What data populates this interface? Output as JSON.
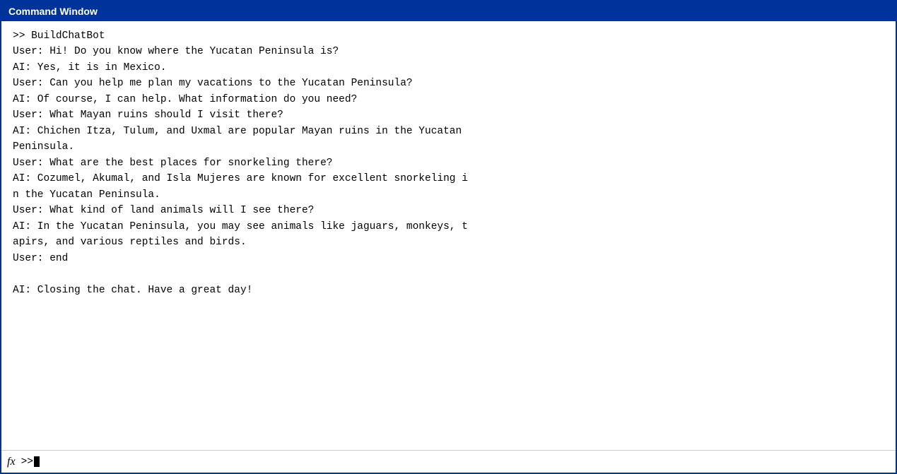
{
  "window": {
    "title": "Command Window"
  },
  "content": {
    "lines": [
      {
        "id": "cmd1",
        "text": ">> BuildChatBot"
      },
      {
        "id": "line1",
        "text": "User: Hi! Do you know where the Yucatan Peninsula is?"
      },
      {
        "id": "line2",
        "text": "AI: Yes, it is in Mexico."
      },
      {
        "id": "line3",
        "text": "User: Can you help me plan my vacations to the Yucatan Peninsula?"
      },
      {
        "id": "line4",
        "text": "AI: Of course, I can help. What information do you need?"
      },
      {
        "id": "line5",
        "text": "User: What Mayan ruins should I visit there?"
      },
      {
        "id": "line6",
        "text": "AI: Chichen Itza, Tulum, and Uxmal are popular Mayan ruins in the Yucatan"
      },
      {
        "id": "line6b",
        "text": "Peninsula."
      },
      {
        "id": "line7",
        "text": "User: What are the best places for snorkeling there?"
      },
      {
        "id": "line8",
        "text": "AI: Cozumel, Akumal, and Isla Mujeres are known for excellent snorkeling i"
      },
      {
        "id": "line8b",
        "text": "n the Yucatan Peninsula."
      },
      {
        "id": "line9",
        "text": "User: What kind of land animals will I see there?"
      },
      {
        "id": "line10",
        "text": "AI: In the Yucatan Peninsula, you may see animals like jaguars, monkeys, t"
      },
      {
        "id": "line10b",
        "text": "apirs, and various reptiles and birds."
      },
      {
        "id": "line11",
        "text": "User: end"
      },
      {
        "id": "line12",
        "text": ""
      },
      {
        "id": "line13",
        "text": "AI: Closing the chat. Have a great day!"
      }
    ],
    "prompt": ">> "
  },
  "bottom": {
    "fx_label": "fx",
    "prompt_text": ">>"
  }
}
